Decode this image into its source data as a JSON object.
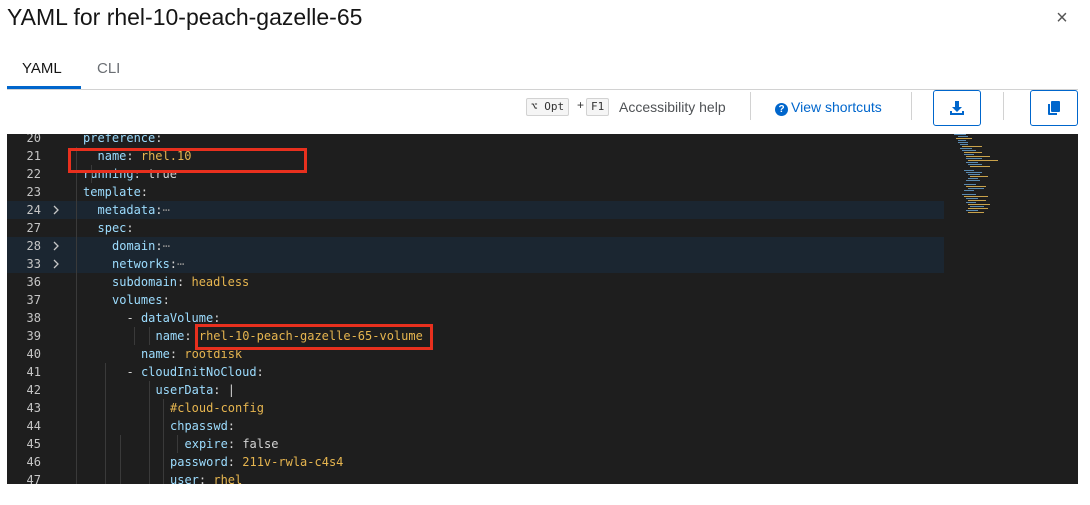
{
  "header": {
    "title": "YAML for rhel-10-peach-gazelle-65",
    "close_symbol": "×"
  },
  "tabs": [
    {
      "label": "YAML",
      "active": true
    },
    {
      "label": "CLI",
      "active": false
    }
  ],
  "toolbar": {
    "shortcut_opt": "⌥ Opt",
    "shortcut_plus": "+",
    "shortcut_f1": "F1",
    "accessibility_help": "Accessibility help",
    "view_shortcuts": "View shortcuts",
    "download_icon": "download-icon",
    "copy_icon": "copy-icon"
  },
  "colors": {
    "accent": "#0066cc",
    "editor_bg": "#1e1e1e",
    "highlight_box": "#e8301e",
    "key": "#9cdcfe",
    "string": "#e6b54f"
  },
  "editor": {
    "lines": [
      {
        "num": "20",
        "indent": 1,
        "key": "preference",
        "sep": ":",
        "value": "",
        "vtype": "plain",
        "fold": false,
        "highlight": false
      },
      {
        "num": "21",
        "indent": 2,
        "key": "name",
        "sep": ": ",
        "value": "rhel.10",
        "vtype": "str",
        "fold": false,
        "highlight": false
      },
      {
        "num": "22",
        "indent": 1,
        "key": "running",
        "sep": ": ",
        "value": "true",
        "vtype": "plain",
        "fold": false,
        "highlight": false
      },
      {
        "num": "23",
        "indent": 1,
        "key": "template",
        "sep": ":",
        "value": "",
        "vtype": "plain",
        "fold": false,
        "highlight": false
      },
      {
        "num": "24",
        "indent": 2,
        "key": "metadata",
        "sep": ":",
        "value": "⋯",
        "vtype": "ellipsis",
        "fold": true,
        "highlight": true
      },
      {
        "num": "27",
        "indent": 2,
        "key": "spec",
        "sep": ":",
        "value": "",
        "vtype": "plain",
        "fold": false,
        "highlight": false
      },
      {
        "num": "28",
        "indent": 3,
        "key": "domain",
        "sep": ":",
        "value": "⋯",
        "vtype": "ellipsis",
        "fold": true,
        "highlight": true
      },
      {
        "num": "33",
        "indent": 3,
        "key": "networks",
        "sep": ":",
        "value": "⋯",
        "vtype": "ellipsis",
        "fold": true,
        "highlight": true
      },
      {
        "num": "36",
        "indent": 3,
        "key": "subdomain",
        "sep": ": ",
        "value": "headless",
        "vtype": "str",
        "fold": false,
        "highlight": false
      },
      {
        "num": "37",
        "indent": 3,
        "key": "volumes",
        "sep": ":",
        "value": "",
        "vtype": "plain",
        "fold": false,
        "highlight": false
      },
      {
        "num": "38",
        "indent": 4,
        "dash": "- ",
        "key": "dataVolume",
        "sep": ":",
        "value": "",
        "vtype": "plain",
        "fold": false,
        "highlight": false
      },
      {
        "num": "39",
        "indent": 6,
        "key": "name",
        "sep": ": ",
        "value": "rhel-10-peach-gazelle-65-volume",
        "vtype": "str",
        "fold": false,
        "highlight": false
      },
      {
        "num": "40",
        "indent": 5,
        "key": "name",
        "sep": ": ",
        "value": "rootdisk",
        "vtype": "str",
        "fold": false,
        "highlight": false
      },
      {
        "num": "41",
        "indent": 4,
        "dash": "- ",
        "key": "cloudInitNoCloud",
        "sep": ":",
        "value": "",
        "vtype": "plain",
        "fold": false,
        "highlight": false
      },
      {
        "num": "42",
        "indent": 6,
        "key": "userData",
        "sep": ": ",
        "value": "|",
        "vtype": "plain",
        "fold": false,
        "highlight": false
      },
      {
        "num": "43",
        "indent": 7,
        "key": "",
        "sep": "",
        "value": "#cloud-config",
        "vtype": "comment",
        "fold": false,
        "highlight": false
      },
      {
        "num": "44",
        "indent": 7,
        "key": "chpasswd",
        "sep": ":",
        "value": "",
        "vtype": "plain",
        "fold": false,
        "highlight": false
      },
      {
        "num": "45",
        "indent": 8,
        "key": "expire",
        "sep": ": ",
        "value": "false",
        "vtype": "plain",
        "fold": false,
        "highlight": false
      },
      {
        "num": "46",
        "indent": 7,
        "key": "password",
        "sep": ": ",
        "value": "211v-rwla-c4s4",
        "vtype": "str",
        "fold": false,
        "highlight": false
      },
      {
        "num": "47",
        "indent": 7,
        "key": "user",
        "sep": ": ",
        "value": "rhel",
        "vtype": "str",
        "fold": false,
        "highlight": false
      }
    ]
  }
}
